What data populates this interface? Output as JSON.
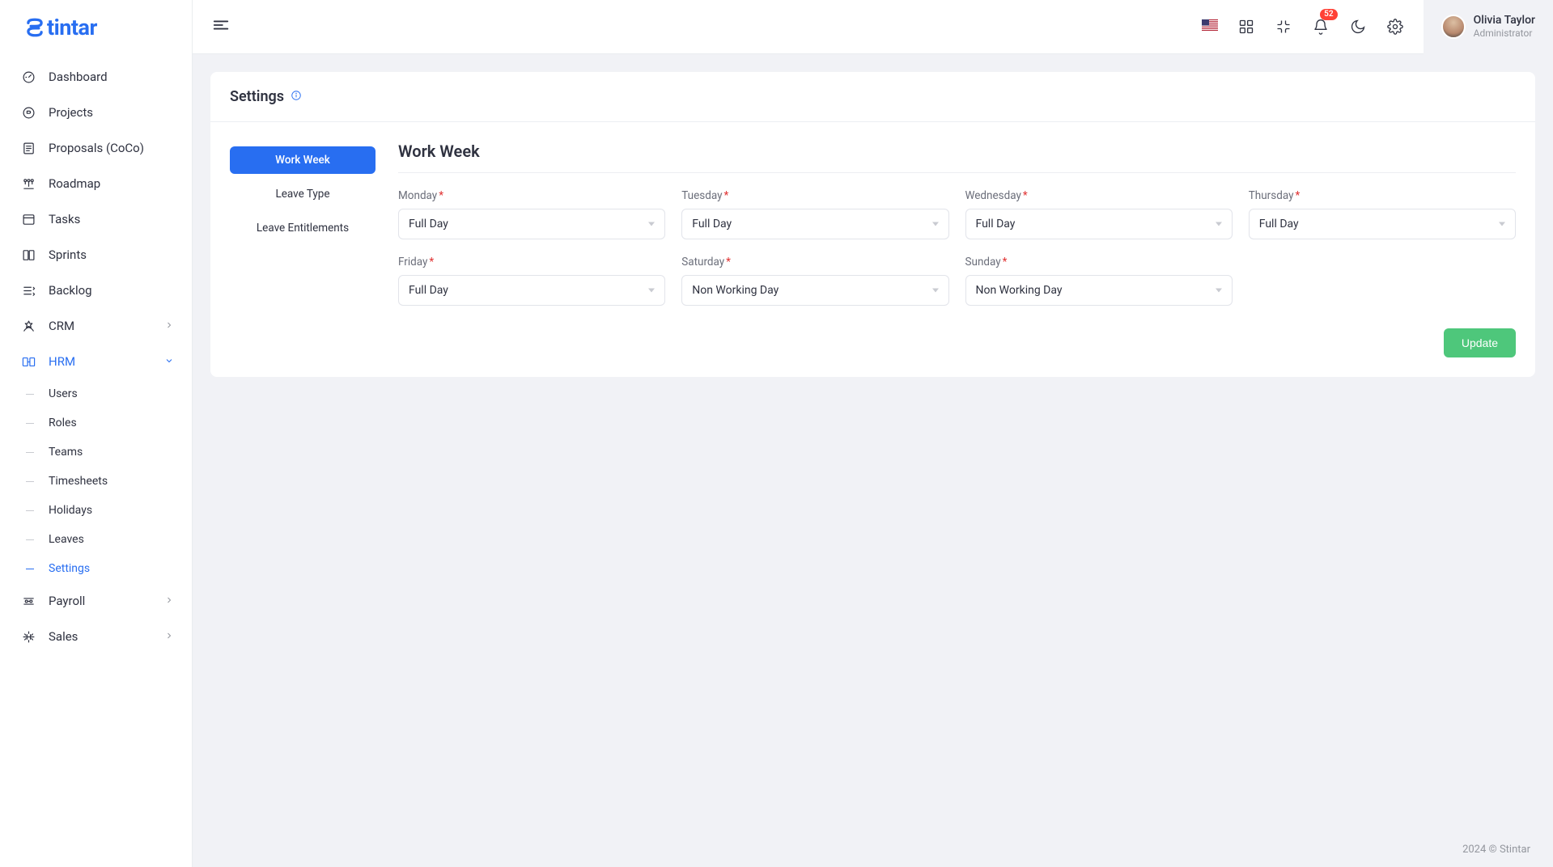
{
  "brand": {
    "text": "tintar"
  },
  "header": {
    "badge_count": "52",
    "user": {
      "name": "Olivia Taylor",
      "role": "Administrator"
    }
  },
  "sidebar": {
    "items": [
      {
        "label": "Dashboard"
      },
      {
        "label": "Projects"
      },
      {
        "label": "Proposals (CoCo)"
      },
      {
        "label": "Roadmap"
      },
      {
        "label": "Tasks"
      },
      {
        "label": "Sprints"
      },
      {
        "label": "Backlog"
      },
      {
        "label": "CRM"
      },
      {
        "label": "HRM"
      },
      {
        "label": "Payroll"
      },
      {
        "label": "Sales"
      }
    ],
    "hrm_children": [
      {
        "label": "Users"
      },
      {
        "label": "Roles"
      },
      {
        "label": "Teams"
      },
      {
        "label": "Timesheets"
      },
      {
        "label": "Holidays"
      },
      {
        "label": "Leaves"
      },
      {
        "label": "Settings"
      }
    ]
  },
  "page": {
    "title": "Settings",
    "tabs": [
      {
        "label": "Work Week"
      },
      {
        "label": "Leave Type"
      },
      {
        "label": "Leave Entitlements"
      }
    ],
    "pane_title": "Work Week",
    "days": [
      {
        "label": "Monday",
        "value": "Full Day"
      },
      {
        "label": "Tuesday",
        "value": "Full Day"
      },
      {
        "label": "Wednesday",
        "value": "Full Day"
      },
      {
        "label": "Thursday",
        "value": "Full Day"
      },
      {
        "label": "Friday",
        "value": "Full Day"
      },
      {
        "label": "Saturday",
        "value": "Non Working Day"
      },
      {
        "label": "Sunday",
        "value": "Non Working Day"
      }
    ],
    "update_label": "Update"
  },
  "footer": {
    "text": "2024 © Stintar"
  }
}
